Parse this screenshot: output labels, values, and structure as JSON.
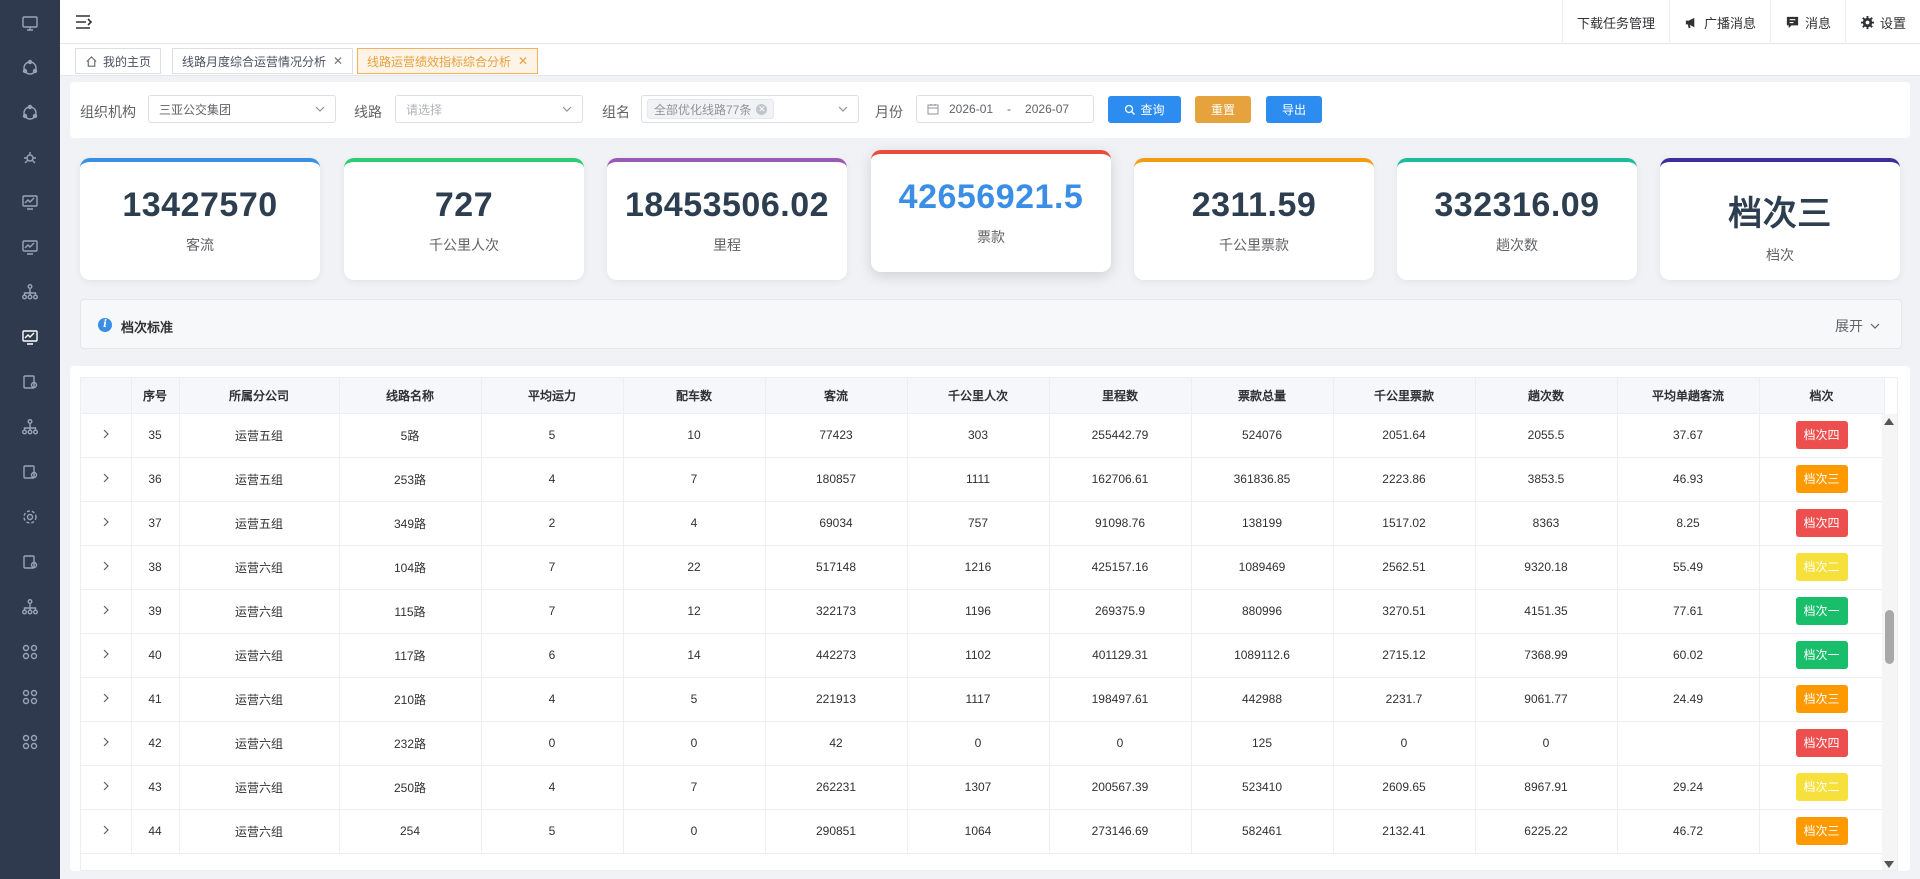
{
  "topbar": {
    "actions": [
      {
        "label": "下载任务管理",
        "icon": "download-icon"
      },
      {
        "label": "广播消息",
        "icon": "megaphone-icon"
      },
      {
        "label": "消息",
        "icon": "message-icon"
      },
      {
        "label": "设置",
        "icon": "gear-icon"
      }
    ]
  },
  "tabs": [
    {
      "label": "我的主页",
      "icon": "home-icon",
      "closable": false,
      "active": false
    },
    {
      "label": "线路月度综合运营情况分析",
      "closable": true,
      "active": false
    },
    {
      "label": "线路运营绩效指标综合分析",
      "closable": true,
      "active": true
    }
  ],
  "filters": {
    "org_label": "组织机构",
    "org_value": "三亚公交集团",
    "line_label": "线路",
    "line_placeholder": "请选择",
    "group_label": "组名",
    "group_chip": "全部优化线路77条",
    "month_label": "月份",
    "month_start": "2026-01",
    "month_sep": "-",
    "month_end": "2026-07",
    "query_label": "查询",
    "reset_label": "重置",
    "export_label": "导出"
  },
  "colors": {
    "query": "#2d8cf0",
    "reset": "#e6a23c",
    "export": "#2d8cf0",
    "grade_one": "#19be6b",
    "grade_two": "#f7e03c",
    "grade_three": "#ff9900",
    "grade_four": "#ed4f4f"
  },
  "cards": [
    {
      "value": "13427570",
      "label": "客流",
      "color": "#3a8ee6"
    },
    {
      "value": "727",
      "label": "千公里人次",
      "color": "#2ecc71"
    },
    {
      "value": "18453506.02",
      "label": "里程",
      "color": "#9b59b6"
    },
    {
      "value": "42656921.5",
      "label": "票款",
      "color": "#e74c3c"
    },
    {
      "value": "2311.59",
      "label": "千公里票款",
      "color": "#f39c12"
    },
    {
      "value": "332316.09",
      "label": "趟次数",
      "color": "#1abc9c"
    },
    {
      "value": "档次三",
      "label": "档次",
      "color": "#3b2f9e"
    }
  ],
  "collapse": {
    "title": "档次标准",
    "expand_label": "展开"
  },
  "table": {
    "headers": [
      "",
      "序号",
      "所属分公司",
      "线路名称",
      "平均运力",
      "配车数",
      "客流",
      "千公里人次",
      "里程数",
      "票款总量",
      "千公里票款",
      "趟次数",
      "平均单趟客流",
      "档次"
    ],
    "rows": [
      [
        "35",
        "运营五组",
        "5路",
        "5",
        "10",
        "77423",
        "303",
        "255442.79",
        "524076",
        "2051.64",
        "2055.5",
        "37.67",
        "档次四"
      ],
      [
        "36",
        "运营五组",
        "253路",
        "4",
        "7",
        "180857",
        "1111",
        "162706.61",
        "361836.85",
        "2223.86",
        "3853.5",
        "46.93",
        "档次三"
      ],
      [
        "37",
        "运营五组",
        "349路",
        "2",
        "4",
        "69034",
        "757",
        "91098.76",
        "138199",
        "1517.02",
        "8363",
        "8.25",
        "档次四"
      ],
      [
        "38",
        "运营六组",
        "104路",
        "7",
        "22",
        "517148",
        "1216",
        "425157.16",
        "1089469",
        "2562.51",
        "9320.18",
        "55.49",
        "档次二"
      ],
      [
        "39",
        "运营六组",
        "115路",
        "7",
        "12",
        "322173",
        "1196",
        "269375.9",
        "880996",
        "3270.51",
        "4151.35",
        "77.61",
        "档次一"
      ],
      [
        "40",
        "运营六组",
        "117路",
        "6",
        "14",
        "442273",
        "1102",
        "401129.31",
        "1089112.6",
        "2715.12",
        "7368.99",
        "60.02",
        "档次一"
      ],
      [
        "41",
        "运营六组",
        "210路",
        "4",
        "5",
        "221913",
        "1117",
        "198497.61",
        "442988",
        "2231.7",
        "9061.77",
        "24.49",
        "档次三"
      ],
      [
        "42",
        "运营六组",
        "232路",
        "0",
        "0",
        "42",
        "0",
        "0",
        "125",
        "0",
        "0",
        "",
        "档次四"
      ],
      [
        "43",
        "运营六组",
        "250路",
        "4",
        "7",
        "262231",
        "1307",
        "200567.39",
        "523410",
        "2609.65",
        "8967.91",
        "29.24",
        "档次二"
      ],
      [
        "44",
        "运营六组",
        "254",
        "5",
        "0",
        "290851",
        "1064",
        "273146.69",
        "582461",
        "2132.41",
        "6225.22",
        "46.72",
        "档次三"
      ]
    ]
  }
}
